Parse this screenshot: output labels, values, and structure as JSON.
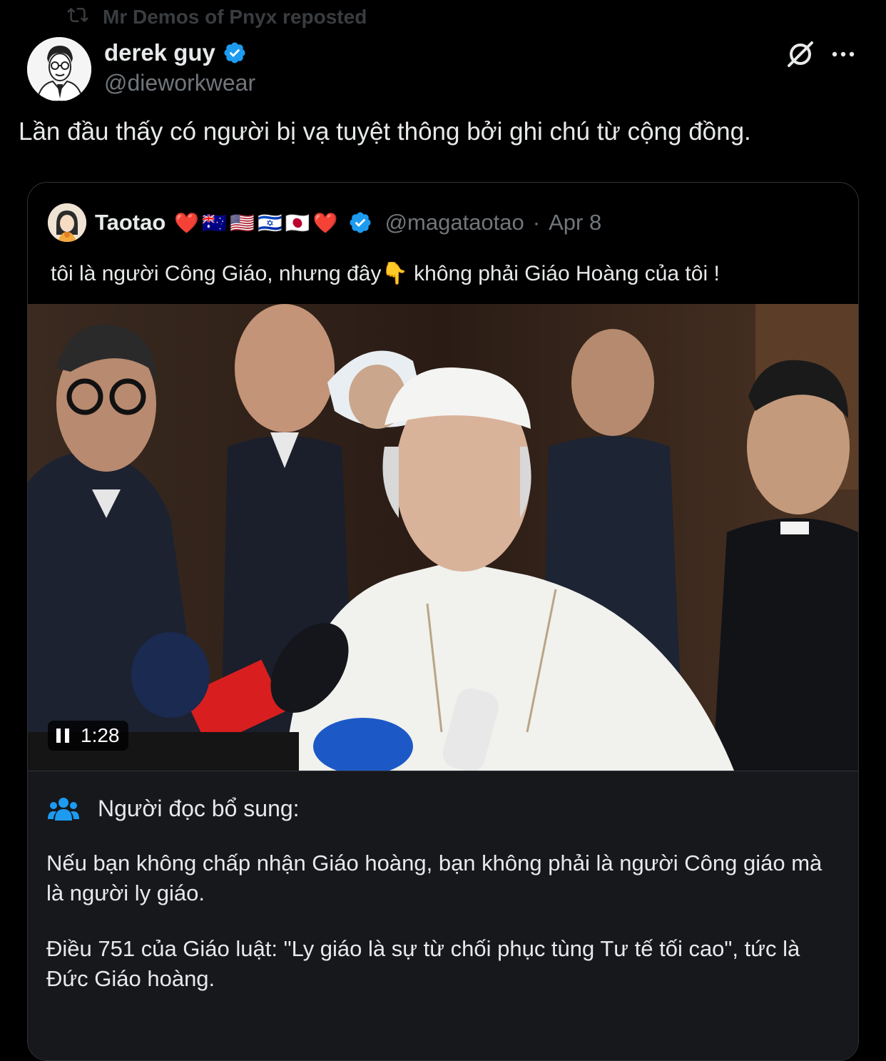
{
  "repost": {
    "label": "Mr Demos of Pnyx reposted"
  },
  "author": {
    "name": "derek guy",
    "handle": "@dieworkwear"
  },
  "tweet": {
    "text": "Lần đầu thấy có người bị vạ tuyệt thông bởi ghi chú từ cộng đồng."
  },
  "quote": {
    "name": "Taotao",
    "name_emojis": [
      "❤️",
      "🇦🇺",
      "🇺🇸",
      "🇮🇱",
      "🇯🇵",
      "❤️"
    ],
    "handle": "@magataotao",
    "separator": "·",
    "date": "Apr 8",
    "text_before": "tôi là người Công Giáo, nhưng đây",
    "text_emoji": "👇",
    "text_after": " không phải Giáo Hoàng của tôi !",
    "video_time": "1:28"
  },
  "community_note": {
    "title": "Người đọc bổ sung:",
    "paragraph1": "Nếu bạn không chấp nhận Giáo hoàng, bạn không phải là người Công giáo mà là người ly giáo.",
    "paragraph2": "Điều 751 của Giáo luật: \"Ly giáo là sự từ chối phục tùng Tư tế tối cao\", tức là Đức Giáo hoàng."
  },
  "icons": {
    "repost": "repost-icon",
    "verified": "verified-badge-icon",
    "grok": "grok-icon",
    "more": "more-icon",
    "pause": "pause-icon",
    "note": "people-icon"
  },
  "colors": {
    "verified": "#1d9bf0",
    "note_icon": "#1d9bf0"
  }
}
